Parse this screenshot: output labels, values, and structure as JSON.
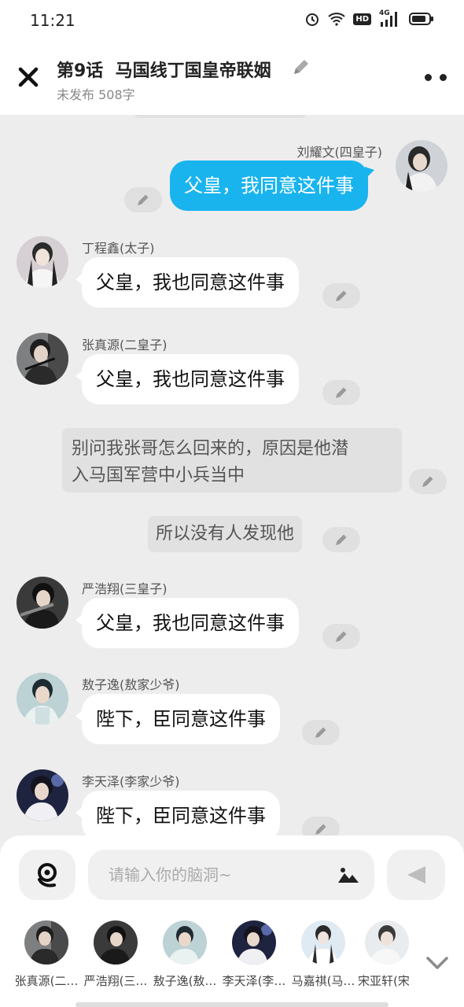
{
  "status_bar": {
    "time": "11:21",
    "icons": [
      "alarm-icon",
      "wifi-icon",
      "hd-icon",
      "signal-4g-icon",
      "battery-icon"
    ],
    "hd_text": "HD",
    "net_text": "4G"
  },
  "header": {
    "title": "第9话  马国线丁国皇帝联姻",
    "subtitle": "未发布 508字"
  },
  "messages": [
    {
      "sender": "刘耀文(四皇子)",
      "text": "父皇，我同意这件事",
      "side": "right"
    },
    {
      "sender": "丁程鑫(太子)",
      "text": "父皇，我也同意这件事",
      "side": "left"
    },
    {
      "sender": "张真源(二皇子)",
      "text": "父皇，我也同意这件事",
      "side": "left"
    },
    {
      "narration": "别问我张哥怎么回来的，原因是他潜入马国军营中小兵当中"
    },
    {
      "narration": "所以没有人发现他"
    },
    {
      "sender": "严浩翔(三皇子)",
      "text": "父皇，我也同意这件事",
      "side": "left"
    },
    {
      "sender": "敖子逸(敖家少爷)",
      "text": "陛下，臣同意这件事",
      "side": "left"
    },
    {
      "sender": "李天泽(李家少爷)",
      "text": "陛下，臣同意这件事",
      "side": "left"
    }
  ],
  "narration_lines": [
    "别问我张哥怎么回来的，原因是他潜",
    "入马国军营中小兵当中"
  ],
  "input": {
    "placeholder": "请输入你的脑洞~",
    "value": ""
  },
  "roles": [
    "张真源(二…",
    "严浩翔(三…",
    "敖子逸(敖…",
    "李天泽(李…",
    "马嘉祺(马…",
    "宋亚轩(宋"
  ],
  "colors": {
    "accent": "#19b4ee",
    "background": "#ededed"
  }
}
